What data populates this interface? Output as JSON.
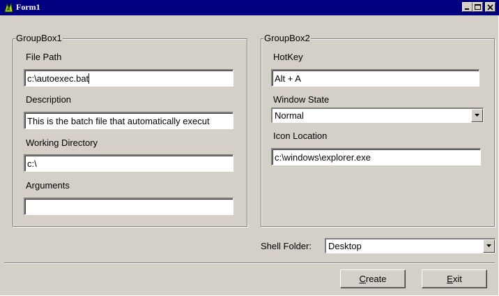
{
  "window": {
    "title": "Form1"
  },
  "groupbox1": {
    "title": "GroupBox1",
    "file_path": {
      "label": "File Path",
      "value": "c:\\autoexec.bat"
    },
    "description": {
      "label": "Description",
      "value": "This is the batch file that automatically execut"
    },
    "working_directory": {
      "label": "Working Directory",
      "value": "c:\\"
    },
    "arguments": {
      "label": "Arguments",
      "value": ""
    }
  },
  "groupbox2": {
    "title": "GroupBox2",
    "hotkey": {
      "label": "HotKey",
      "value": "Alt + A"
    },
    "window_state": {
      "label": "Window State",
      "selected": "Normal"
    },
    "icon_location": {
      "label": "Icon Location",
      "value": "c:\\windows\\explorer.exe"
    }
  },
  "shell_folder": {
    "label": "Shell Folder:",
    "selected": "Desktop"
  },
  "buttons": {
    "create": {
      "mnemonic": "C",
      "rest": "reate"
    },
    "exit": {
      "mnemonic": "E",
      "rest": "xit"
    }
  },
  "colors": {
    "titlebar": "#000080",
    "face": "#d4d0c8"
  }
}
